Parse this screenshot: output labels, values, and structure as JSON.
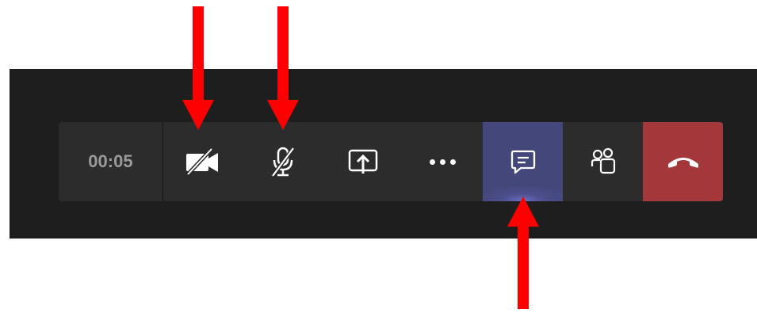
{
  "call_toolbar": {
    "timer_text": "00:05",
    "buttons": [
      {
        "id": "camera",
        "icon": "video-off-icon",
        "state": "off"
      },
      {
        "id": "microphone",
        "icon": "mic-off-icon",
        "state": "muted"
      },
      {
        "id": "share",
        "icon": "share-screen-icon"
      },
      {
        "id": "more",
        "icon": "more-options-icon"
      },
      {
        "id": "chat",
        "icon": "chat-icon",
        "state": "active"
      },
      {
        "id": "participants",
        "icon": "people-icon"
      },
      {
        "id": "hangup",
        "icon": "hang-up-icon"
      }
    ]
  },
  "annotations": [
    {
      "icon": "red-arrow-down",
      "target": "camera"
    },
    {
      "icon": "red-arrow-down",
      "target": "microphone"
    },
    {
      "icon": "red-arrow-up",
      "target": "chat"
    }
  ],
  "colors": {
    "background": "#ffffff",
    "band": "#1e1e1e",
    "toolbar": "#2d2c2c",
    "timer_text": "#9a9a9a",
    "chat_active": "#44477a",
    "hangup": "#a4373a",
    "arrow": "#ff0000"
  }
}
